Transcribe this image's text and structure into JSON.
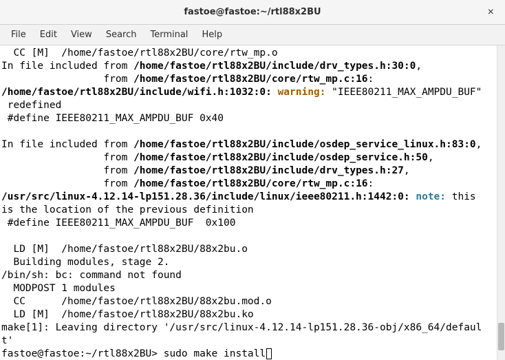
{
  "window": {
    "title": "fastoe@fastoe:~/rtl88x2BU",
    "close_glyph": "×"
  },
  "menu": {
    "file": "File",
    "edit": "Edit",
    "view": "View",
    "search": "Search",
    "terminal": "Terminal",
    "help": "Help"
  },
  "term": {
    "l01": "  CC [M]  /home/fastoe/rtl88x2BU/core/rtw_mp.o",
    "l02a": "In file included from ",
    "l02b": "/home/fastoe/rtl88x2BU/include/drv_types.h:30:0",
    "l02c": ",",
    "l03a": "                 from ",
    "l03b": "/home/fastoe/rtl88x2BU/core/rtw_mp.c:16",
    "l03c": ":",
    "l04a": "/home/fastoe/rtl88x2BU/include/wifi.h:1032:0:",
    "l04b": " ",
    "l04w": "warning:",
    "l04c": " \"IEEE80211_MAX_AMPDU_BUF\"",
    "l05": " redefined",
    "l06": " #define IEEE80211_MAX_AMPDU_BUF 0x40",
    "l07": "",
    "l08a": "In file included from ",
    "l08b": "/home/fastoe/rtl88x2BU/include/osdep_service_linux.h:83:0",
    "l08c": ",",
    "l09a": "                 from ",
    "l09b": "/home/fastoe/rtl88x2BU/include/osdep_service.h:50",
    "l09c": ",",
    "l10a": "                 from ",
    "l10b": "/home/fastoe/rtl88x2BU/include/drv_types.h:27",
    "l10c": ",",
    "l11a": "                 from ",
    "l11b": "/home/fastoe/rtl88x2BU/core/rtw_mp.c:16",
    "l11c": ":",
    "l12a": "/usr/src/linux-4.12.14-lp151.28.36/include/linux/ieee80211.h:1442:0:",
    "l12b": " ",
    "l12n": "note:",
    "l12c": " this",
    "l13": "is the location of the previous definition",
    "l14": " #define IEEE80211_MAX_AMPDU_BUF  0x100",
    "l15": "",
    "l16": "  LD [M]  /home/fastoe/rtl88x2BU/88x2bu.o",
    "l17": "  Building modules, stage 2.",
    "l18": "/bin/sh: bc: command not found",
    "l19": "  MODPOST 1 modules",
    "l20": "  CC      /home/fastoe/rtl88x2BU/88x2bu.mod.o",
    "l21": "  LD [M]  /home/fastoe/rtl88x2BU/88x2bu.ko",
    "l22": "make[1]: Leaving directory '/usr/src/linux-4.12.14-lp151.28.36-obj/x86_64/defaul",
    "l23": "t'",
    "prompt": "fastoe@fastoe:~/rtl88x2BU>",
    "cmd": " sudo make install"
  }
}
